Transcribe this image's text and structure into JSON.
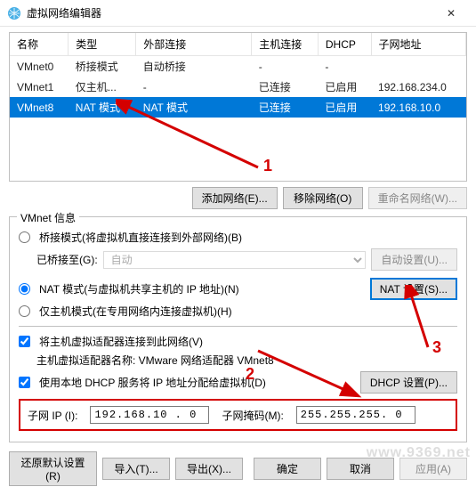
{
  "window": {
    "title": "虚拟网络编辑器",
    "close": "✕"
  },
  "table": {
    "headers": [
      "名称",
      "类型",
      "外部连接",
      "主机连接",
      "DHCP",
      "子网地址"
    ],
    "rows": [
      {
        "cells": [
          "VMnet0",
          "桥接模式",
          "自动桥接",
          "-",
          "-",
          ""
        ],
        "selected": false
      },
      {
        "cells": [
          "VMnet1",
          "仅主机...",
          "-",
          "已连接",
          "已启用",
          "192.168.234.0"
        ],
        "selected": false
      },
      {
        "cells": [
          "VMnet8",
          "NAT 模式",
          "NAT 模式",
          "已连接",
          "已启用",
          "192.168.10.0"
        ],
        "selected": true
      }
    ]
  },
  "table_buttons": {
    "add": "添加网络(E)...",
    "remove": "移除网络(O)",
    "rename": "重命名网络(W)..."
  },
  "group": {
    "title": "VMnet 信息",
    "radio_bridge": "桥接模式(将虚拟机直接连接到外部网络)(B)",
    "bridge_to_label": "已桥接至(G):",
    "bridge_to_value": "自动",
    "bridge_auto_btn": "自动设置(U)...",
    "radio_nat": "NAT 模式(与虚拟机共享主机的 IP 地址)(N)",
    "nat_btn": "NAT 设置(S)...",
    "radio_host": "仅主机模式(在专用网络内连接虚拟机)(H)",
    "chk_connect": "将主机虚拟适配器连接到此网络(V)",
    "adapter_label": "主机虚拟适配器名称: VMware 网络适配器 VMnet8",
    "chk_dhcp": "使用本地 DHCP 服务将 IP 地址分配给虚拟机(D)",
    "dhcp_btn": "DHCP 设置(P)...",
    "subnet_ip_label": "子网 IP (I):",
    "subnet_ip_value": "192.168.10 . 0",
    "subnet_mask_label": "子网掩码(M):",
    "subnet_mask_value": "255.255.255. 0"
  },
  "bottom": {
    "restore": "还原默认设置(R)",
    "import": "导入(T)...",
    "export": "导出(X)...",
    "ok": "确定",
    "cancel": "取消",
    "apply": "应用(A)"
  },
  "annotations": {
    "a1": "1",
    "a2": "2",
    "a3": "3"
  },
  "watermark": "www.9369.net"
}
